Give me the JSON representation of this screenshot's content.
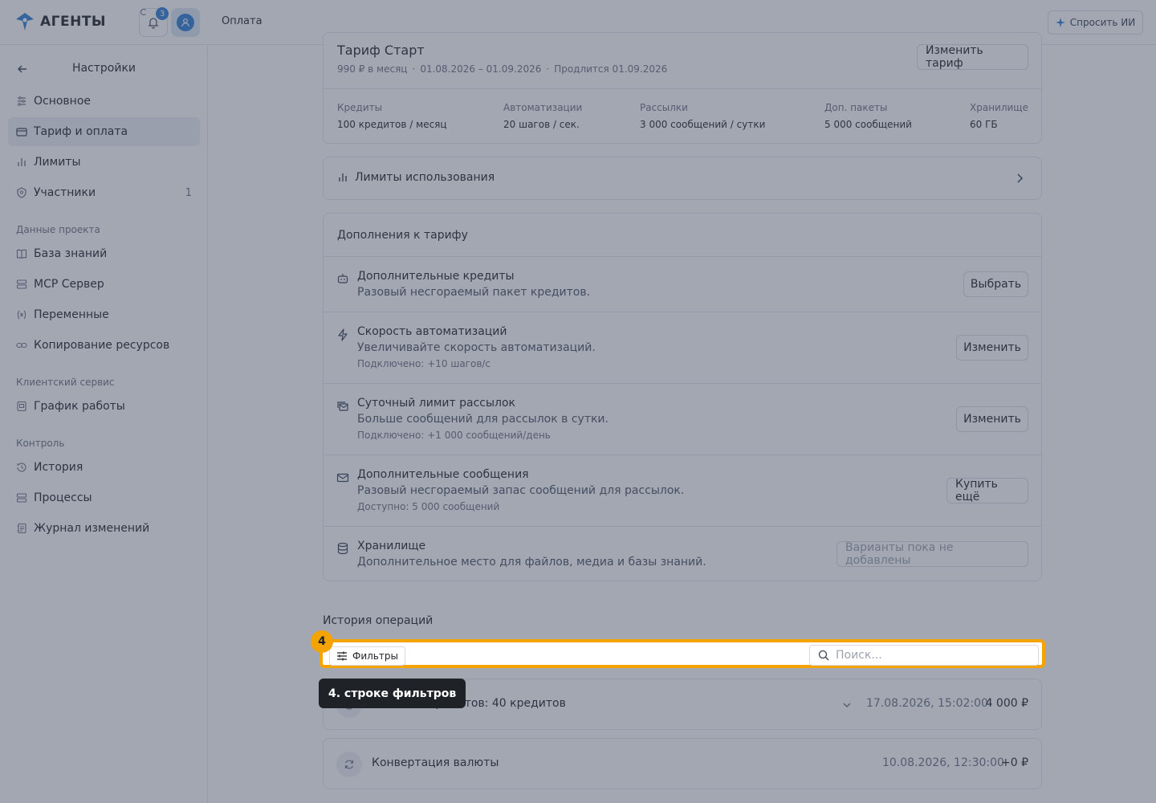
{
  "app": {
    "brand": "АГЕНТЫ",
    "notifications_count": "3",
    "page_title": "Оплата",
    "ask_ai_label": "Спросить ИИ"
  },
  "sidebar": {
    "title": "Настройки",
    "items_main": [
      {
        "label": "Основное",
        "icon": "sliders-icon"
      },
      {
        "label": "Тариф и оплата",
        "icon": "credit-card-icon",
        "active": true
      },
      {
        "label": "Лимиты",
        "icon": "bar-chart-icon"
      },
      {
        "label": "Участники",
        "icon": "users-icon",
        "count": "1"
      }
    ],
    "group_project": "Данные проекта",
    "items_project": [
      {
        "label": "База знаний",
        "icon": "book-icon"
      },
      {
        "label": "MCP Сервер",
        "icon": "server-icon"
      },
      {
        "label": "Переменные",
        "icon": "variable-icon"
      },
      {
        "label": "Копирование ресурсов",
        "icon": "link-icon"
      }
    ],
    "group_service": "Клиентский сервис",
    "items_service": [
      {
        "label": "График работы",
        "icon": "calendar-icon"
      }
    ],
    "group_control": "Контроль",
    "items_control": [
      {
        "label": "История",
        "icon": "history-icon"
      },
      {
        "label": "Процессы",
        "icon": "process-icon"
      },
      {
        "label": "Журнал изменений",
        "icon": "log-icon"
      }
    ]
  },
  "plan": {
    "name": "Тариф Старт",
    "price": "990 ₽ в месяц",
    "period": "01.08.2026 – 01.09.2026",
    "renewal": "Продлится 01.09.2026",
    "change_button": "Изменить тариф",
    "stats": [
      {
        "label": "Кредиты",
        "value": "100 кредитов / месяц"
      },
      {
        "label": "Автоматизации",
        "value": "20 шагов / сек."
      },
      {
        "label": "Рассылки",
        "value": "3 000 сообщений / сутки"
      },
      {
        "label": "Доп. пакеты",
        "value": "5 000 сообщений"
      },
      {
        "label": "Хранилище",
        "value": "60 ГБ"
      }
    ]
  },
  "limits": {
    "title": "Лимиты использования"
  },
  "addons": {
    "title": "Дополнения к тарифу",
    "rows": [
      {
        "title": "Дополнительные кредиты",
        "desc": "Разовый несгораемый пакет кредитов.",
        "note": "",
        "button": "Выбрать"
      },
      {
        "title": "Скорость автоматизаций",
        "desc": "Увеличивайте скорость автоматизаций.",
        "note": "Подключено: +10 шагов/с",
        "button": "Изменить"
      },
      {
        "title": "Суточный лимит рассылок",
        "desc": "Больше сообщений для рассылок в сутки.",
        "note": "Подключено: +1 000 сообщений/день",
        "button": "Изменить"
      },
      {
        "title": "Дополнительные сообщения",
        "desc": "Разовый несгораемый запас сообщений для рассылок.",
        "note": "Доступно: 5 000 сообщений",
        "button": "Купить ещё"
      },
      {
        "title": "Хранилище",
        "desc": "Дополнительное место для файлов, медиа и базы знаний.",
        "note": "",
        "button": "Варианты пока не добавлены"
      }
    ]
  },
  "history": {
    "title": "История операций",
    "filters_label": "Фильтры",
    "search_placeholder": "Поиск...",
    "operations": [
      {
        "title": "Покупка кредитов: 40 кредитов",
        "title_visible": "а кредитов: 40 кредитов",
        "date": "17.08.2026, 15:02:00",
        "amount": "4 000 ₽"
      },
      {
        "title": "Конвертация валюты",
        "date": "10.08.2026, 12:30:00",
        "amount": "+0 ₽"
      }
    ]
  },
  "tour": {
    "step": "4",
    "tooltip": "4. строке фильтров"
  },
  "colors": {
    "accent": "#2f7fd6",
    "highlight": "#f5a300",
    "tooltip_bg": "#1f2328"
  }
}
